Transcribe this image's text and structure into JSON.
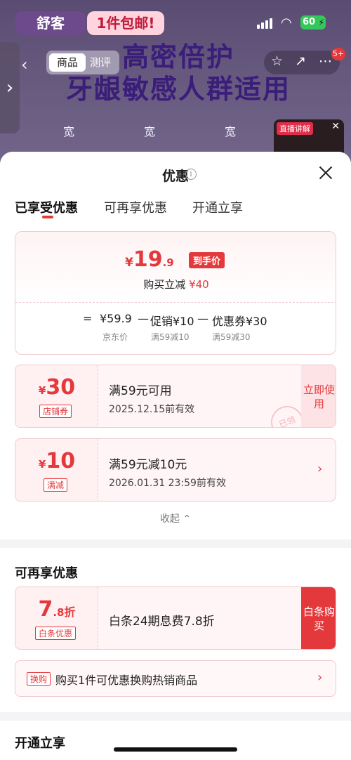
{
  "background": {
    "brand_logo": "舒客",
    "promo_tag": "1件包邮!",
    "battery": "60",
    "nav_tab_active": "商品",
    "nav_tab_other": "测评",
    "hero_line1": "高密倍护",
    "hero_line2": "牙龈敏感人群适用",
    "cart_badge": "5+",
    "product_label": "宽",
    "live_label": "直播讲解"
  },
  "sheet": {
    "title": "优惠",
    "tabs": [
      "已享受优惠",
      "可再享优惠",
      "开通立享"
    ],
    "summary": {
      "currency": "¥",
      "price_int": "19",
      "price_dec": ".9",
      "final_tag": "到手价",
      "saving_label": "购买立减",
      "saving_amount": "¥40",
      "formula": {
        "eq": "=",
        "base": "¥59.9",
        "minus": "—",
        "promo": "促销¥10",
        "coupon": "优惠券¥30",
        "base_label": "京东价",
        "promo_label": "满59减10",
        "coupon_label": "满59减30"
      }
    },
    "coupons": [
      {
        "currency": "¥",
        "amount": "30",
        "type": "店铺券",
        "title": "满59元可用",
        "subtitle": "2025.12.15前有效",
        "action": "立即使用",
        "stamp": "已领"
      },
      {
        "currency": "¥",
        "amount": "10",
        "type": "满减",
        "title": "满59元减10元",
        "subtitle": "2026.01.31 23:59前有效",
        "arrow": "›"
      }
    ],
    "collapse": "收起 ⌃"
  },
  "more_offers": {
    "title": "可再享优惠",
    "baitiao": {
      "amount": "7",
      "decimal": ".8",
      "unit": "折",
      "type": "白条优惠",
      "title": "白条24期息费7.8折",
      "action": "白条购买"
    },
    "swap": {
      "badge": "换购",
      "text": "购买1件可优惠换购热销商品",
      "arrow": "›"
    }
  },
  "open_section": {
    "title": "开通立享"
  },
  "colors": {
    "accent": "#e4393c",
    "card_border": "#f1c9cf",
    "card_bg": "#fff5f6"
  }
}
